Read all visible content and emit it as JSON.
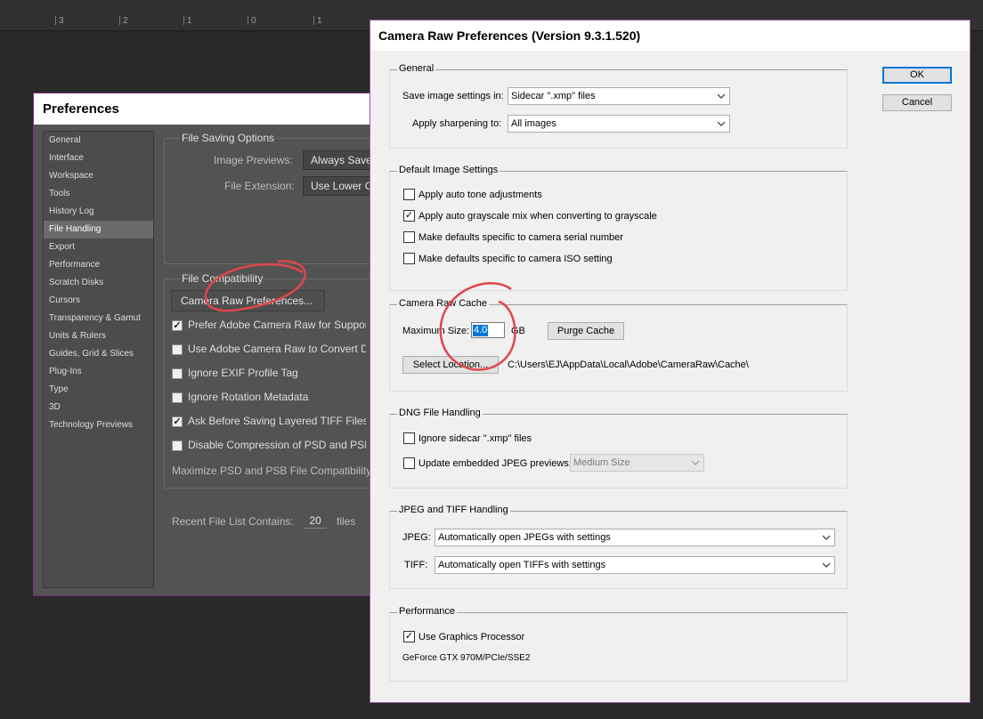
{
  "ruler": {
    "numbers": [
      "3",
      "2",
      "1",
      "0",
      "1"
    ]
  },
  "ps_prefs": {
    "title": "Preferences",
    "sidebar": [
      "General",
      "Interface",
      "Workspace",
      "Tools",
      "History Log",
      "File Handling",
      "Export",
      "Performance",
      "Scratch Disks",
      "Cursors",
      "Transparency & Gamut",
      "Units & Rulers",
      "Guides, Grid & Slices",
      "Plug-Ins",
      "Type",
      "3D",
      "Technology Previews"
    ],
    "selected_index": 5,
    "file_saving": {
      "legend": "File Saving Options",
      "image_previews_label": "Image Previews:",
      "image_previews_value": "Always Save",
      "file_extension_label": "File Extension:",
      "file_extension_value": "Use Lower Case"
    },
    "file_compat": {
      "legend": "File Compatibility",
      "camera_raw_button": "Camera Raw Preferences...",
      "options": [
        {
          "label": "Prefer Adobe Camera Raw for Supported Raw Files",
          "checked": true
        },
        {
          "label": "Use Adobe Camera Raw to Convert Documents",
          "checked": false
        },
        {
          "label": "Ignore EXIF Profile Tag",
          "checked": false
        },
        {
          "label": "Ignore Rotation Metadata",
          "checked": false
        },
        {
          "label": "Ask Before Saving Layered TIFF Files",
          "checked": true
        },
        {
          "label": "Disable Compression of PSD and PSB Files",
          "checked": false
        }
      ],
      "maximize_label": "Maximize PSD and PSB File Compatibility:"
    },
    "recent": {
      "label": "Recent File List Contains:",
      "value": "20",
      "suffix": "files"
    }
  },
  "camera_raw": {
    "title": "Camera Raw Preferences  (Version 9.3.1.520)",
    "ok": "OK",
    "cancel": "Cancel",
    "general": {
      "legend": "General",
      "save_label": "Save image settings in:",
      "save_value": "Sidecar \".xmp\" files",
      "sharpen_label": "Apply sharpening to:",
      "sharpen_value": "All images"
    },
    "defaults": {
      "legend": "Default Image Settings",
      "options": [
        {
          "label": "Apply auto tone adjustments",
          "checked": false
        },
        {
          "label": "Apply auto grayscale mix when converting to grayscale",
          "checked": true
        },
        {
          "label": "Make defaults specific to camera serial number",
          "checked": false
        },
        {
          "label": "Make defaults specific to camera ISO setting",
          "checked": false
        }
      ]
    },
    "cache": {
      "legend": "Camera Raw Cache",
      "max_label": "Maximum Size:",
      "max_value": "4.0",
      "unit": "GB",
      "purge": "Purge Cache",
      "select": "Select Location...",
      "path": "C:\\Users\\EJ\\AppData\\Local\\Adobe\\CameraRaw\\Cache\\"
    },
    "dng": {
      "legend": "DNG File Handling",
      "ignore_label": "Ignore sidecar \".xmp\" files",
      "ignore_checked": false,
      "update_label": "Update embedded JPEG previews:",
      "update_checked": false,
      "update_value": "Medium Size"
    },
    "jpeg_tiff": {
      "legend": "JPEG and TIFF Handling",
      "jpeg_label": "JPEG:",
      "jpeg_value": "Automatically open JPEGs with settings",
      "tiff_label": "TIFF:",
      "tiff_value": "Automatically open TIFFs with settings"
    },
    "performance": {
      "legend": "Performance",
      "gpu_label": "Use Graphics Processor",
      "gpu_checked": true,
      "gpu_name": "GeForce GTX 970M/PCIe/SSE2"
    }
  },
  "colors": {
    "annotation": "#e0474c",
    "dialog_border": "#9b5b9b",
    "accent": "#0078d7"
  },
  "icons": {
    "checkbox": "check-mark-icon",
    "dropdown": "chevron-down-icon"
  }
}
